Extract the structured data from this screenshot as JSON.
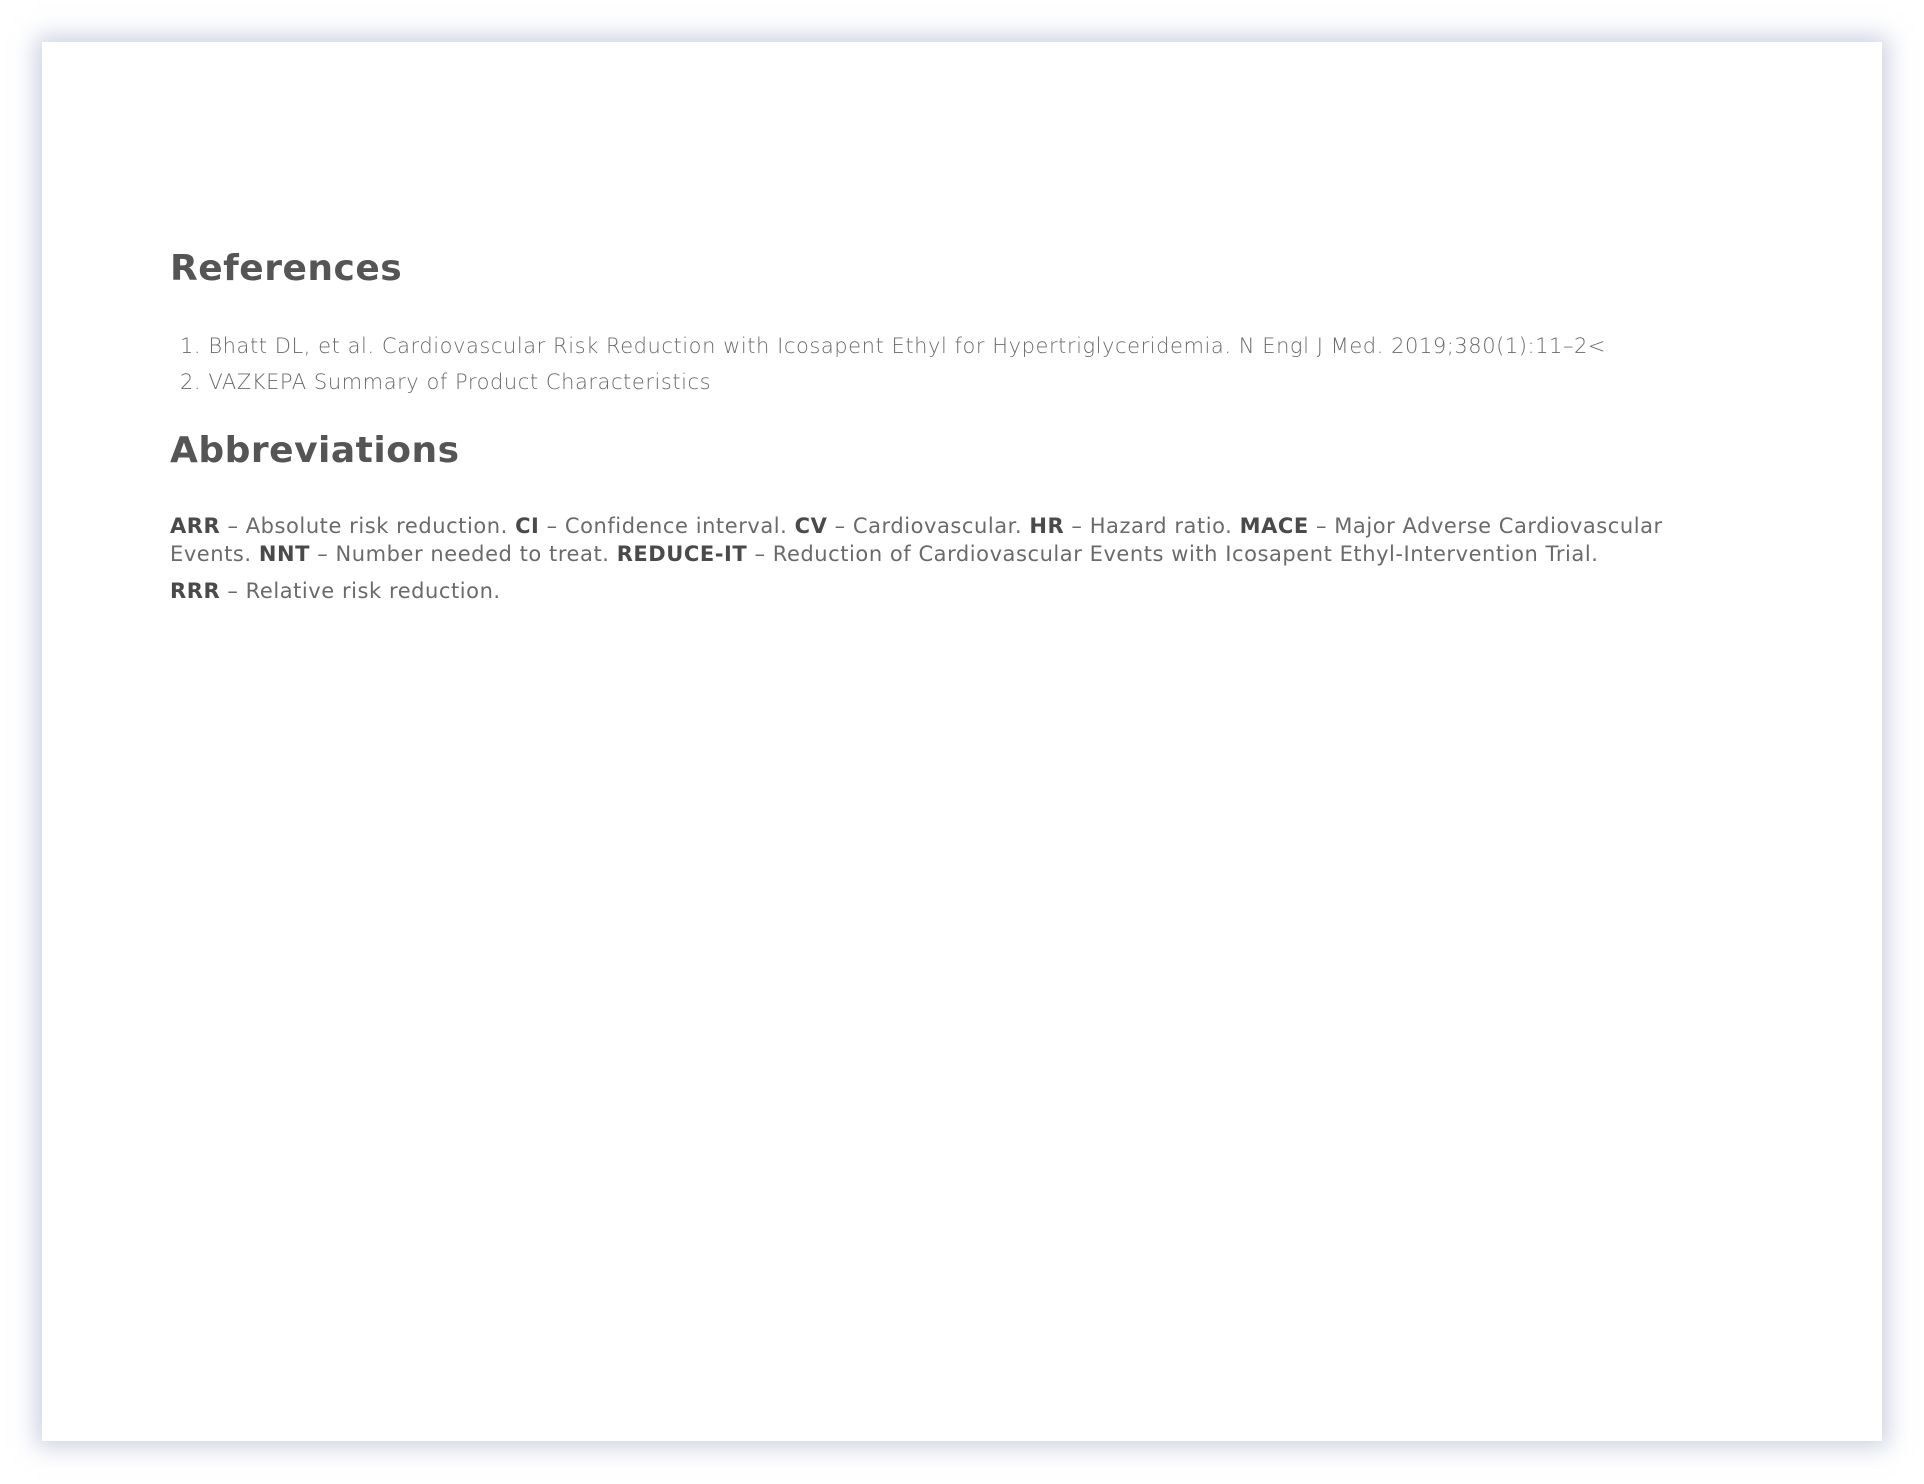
{
  "references": {
    "heading": "References",
    "items": [
      "1. Bhatt DL, et al. Cardiovascular Risk Reduction with Icosapent Ethyl for Hypertriglyceridemia. N Engl J Med. 2019;380(1):11–2<",
      "2. VAZKEPA Summary of Product Characteristics"
    ]
  },
  "abbreviations": {
    "heading": "Abbreviations",
    "items": [
      {
        "term": "ARR",
        "def": " – Absolute risk reduction. "
      },
      {
        "term": "CI",
        "def": " – Confidence interval. "
      },
      {
        "term": "CV",
        "def": " – Cardiovascular. "
      },
      {
        "term": "HR",
        "def": " – Hazard ratio. "
      },
      {
        "term": "MACE",
        "def": " – Major Adverse Cardiovascular Events. "
      },
      {
        "term": "NNT",
        "def": " – Number needed to treat. "
      },
      {
        "term": "REDUCE-IT",
        "def": " – Reduction of Cardiovascular Events with Icosapent Ethyl-Intervention Trial."
      },
      {
        "term": "RRR",
        "def": " – Relative risk reduction."
      }
    ]
  }
}
